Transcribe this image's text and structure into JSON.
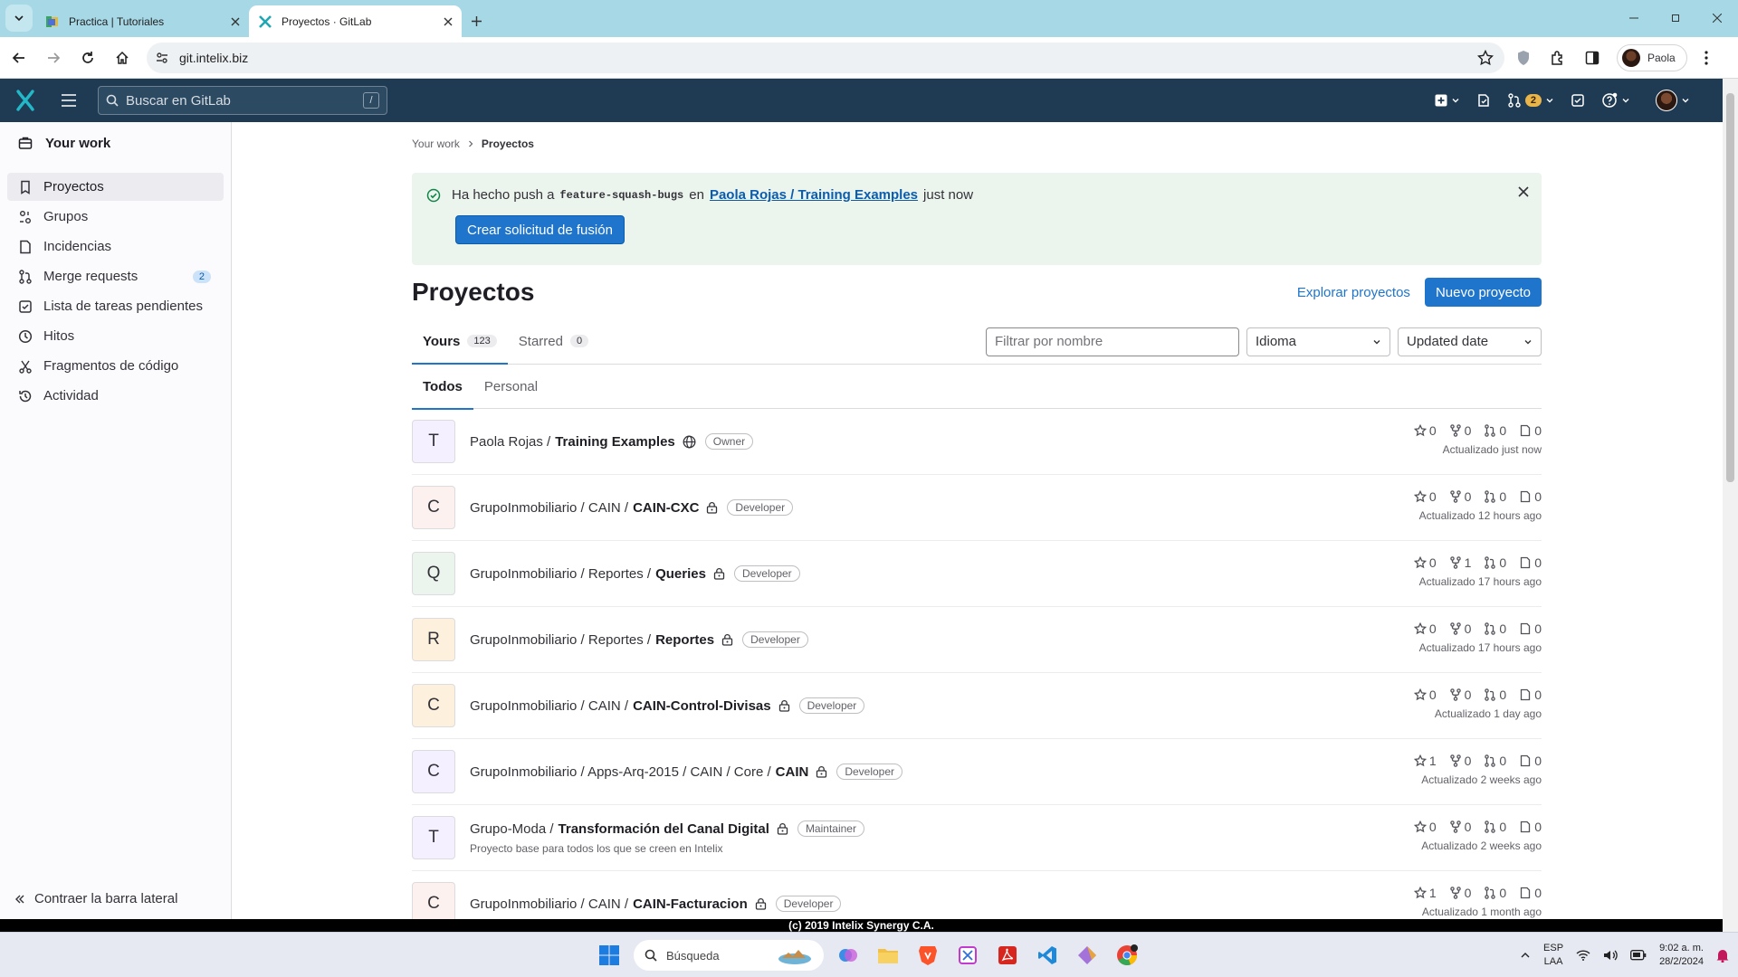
{
  "browser": {
    "tabs": [
      {
        "title": "Practica | Tutoriales",
        "active": false
      },
      {
        "title": "Proyectos · GitLab",
        "active": true
      }
    ],
    "url": "git.intelix.biz",
    "profile_name": "Paola"
  },
  "gitlab_header": {
    "search_placeholder": "Buscar en GitLab",
    "search_shortcut": "/",
    "merge_requests_count": "2"
  },
  "sidebar": {
    "section_title": "Your work",
    "items": [
      {
        "label": "Proyectos",
        "icon": "project-icon",
        "active": true
      },
      {
        "label": "Grupos",
        "icon": "group-icon"
      },
      {
        "label": "Incidencias",
        "icon": "issues-icon"
      },
      {
        "label": "Merge requests",
        "icon": "merge-request-icon",
        "count": "2"
      },
      {
        "label": "Lista de tareas pendientes",
        "icon": "todo-icon"
      },
      {
        "label": "Hitos",
        "icon": "milestone-icon"
      },
      {
        "label": "Fragmentos de código",
        "icon": "snippet-icon"
      },
      {
        "label": "Actividad",
        "icon": "history-icon"
      }
    ],
    "collapse_label": "Contraer la barra lateral"
  },
  "breadcrumb": {
    "parent": "Your work",
    "current": "Proyectos"
  },
  "alert": {
    "prefix": "Ha hecho push a",
    "branch": "feature-squash-bugs",
    "middle": "en",
    "project_link": "Paola Rojas / Training Examples",
    "suffix": "just now",
    "button_label": "Crear solicitud de fusión"
  },
  "page": {
    "title": "Proyectos",
    "explore_label": "Explorar proyectos",
    "new_project_label": "Nuevo proyecto"
  },
  "tabs": [
    {
      "label": "Yours",
      "count": "123",
      "active": true
    },
    {
      "label": "Starred",
      "count": "0",
      "active": false
    }
  ],
  "filters": {
    "name_placeholder": "Filtrar por nombre",
    "language_label": "Idioma",
    "sort_label": "Updated date"
  },
  "subtabs": [
    {
      "label": "Todos",
      "active": true
    },
    {
      "label": "Personal",
      "active": false
    }
  ],
  "projects": [
    {
      "letter": "T",
      "avatar_color": "#f4f0ff",
      "namespace": "Paola Rojas /",
      "name": "Training Examples",
      "visibility": "public",
      "role": "Owner",
      "stars": "0",
      "forks": "0",
      "mrs": "0",
      "issues": "0",
      "updated": "Actualizado just now"
    },
    {
      "letter": "C",
      "avatar_color": "#fcf1ef",
      "namespace": "GrupoInmobiliario / CAIN /",
      "name": "CAIN-CXC",
      "visibility": "private",
      "role": "Developer",
      "stars": "0",
      "forks": "0",
      "mrs": "0",
      "issues": "0",
      "updated": "Actualizado 12 hours ago"
    },
    {
      "letter": "Q",
      "avatar_color": "#ecf4ee",
      "namespace": "GrupoInmobiliario / Reportes /",
      "name": "Queries",
      "visibility": "private",
      "role": "Developer",
      "stars": "0",
      "forks": "1",
      "mrs": "0",
      "issues": "0",
      "updated": "Actualizado 17 hours ago"
    },
    {
      "letter": "R",
      "avatar_color": "#fdf1dd",
      "namespace": "GrupoInmobiliario / Reportes /",
      "name": "Reportes",
      "visibility": "private",
      "role": "Developer",
      "stars": "0",
      "forks": "0",
      "mrs": "0",
      "issues": "0",
      "updated": "Actualizado 17 hours ago"
    },
    {
      "letter": "C",
      "avatar_color": "#fdf1dd",
      "namespace": "GrupoInmobiliario / CAIN /",
      "name": "CAIN-Control-Divisas",
      "visibility": "private",
      "role": "Developer",
      "stars": "0",
      "forks": "0",
      "mrs": "0",
      "issues": "0",
      "updated": "Actualizado 1 day ago"
    },
    {
      "letter": "C",
      "avatar_color": "#f4f0ff",
      "namespace": "GrupoInmobiliario / Apps-Arq-2015 / CAIN / Core /",
      "name": "CAIN",
      "visibility": "private",
      "role": "Developer",
      "stars": "1",
      "forks": "0",
      "mrs": "0",
      "issues": "0",
      "updated": "Actualizado 2 weeks ago"
    },
    {
      "letter": "T",
      "avatar_color": "#f4f0ff",
      "namespace": "Grupo-Moda /",
      "name": "Transformación del Canal Digital",
      "visibility": "private",
      "role": "Maintainer",
      "description": "Proyecto base para todos los que se creen en Intelix",
      "stars": "0",
      "forks": "0",
      "mrs": "0",
      "issues": "0",
      "updated": "Actualizado 2 weeks ago"
    },
    {
      "letter": "C",
      "avatar_color": "#fcf1ef",
      "namespace": "GrupoInmobiliario / CAIN /",
      "name": "CAIN-Facturacion",
      "visibility": "private",
      "role": "Developer",
      "stars": "1",
      "forks": "0",
      "mrs": "0",
      "issues": "0",
      "updated": "Actualizado 1 month ago"
    }
  ],
  "footer": "(c) 2019 Intelix Synergy C.A.",
  "taskbar": {
    "search_label": "Búsqueda",
    "lang_top": "ESP",
    "lang_bottom": "LAA",
    "time": "9:02 a. m.",
    "date": "28/2/2024"
  }
}
